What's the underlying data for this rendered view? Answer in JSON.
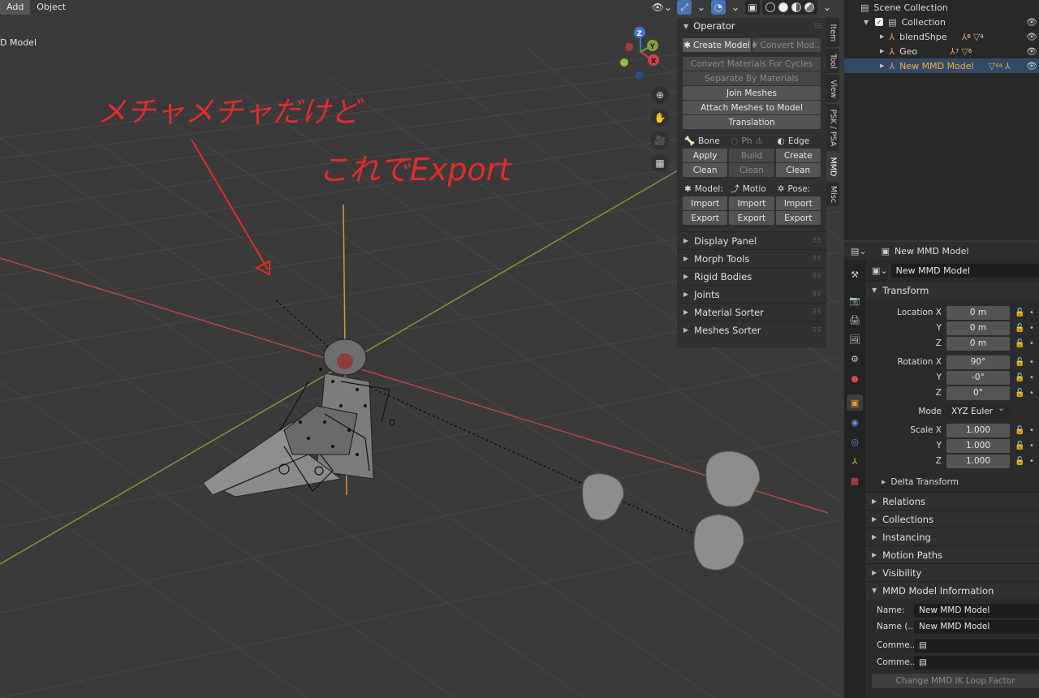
{
  "viewport": {
    "menu": [
      "Add",
      "Object"
    ],
    "label": "D Model",
    "annotation_a": "メチャメチャだけど",
    "annotation_b": "これでExport",
    "colors": {
      "x_axis": "#c94a4a",
      "y_axis": "#7fa33a",
      "z_axis": "#e0923a",
      "ink": "#e22b2b"
    }
  },
  "gizmo": {
    "x": "X",
    "y": "Y",
    "z": "Z"
  },
  "npanel": {
    "operator": {
      "title": "Operator",
      "create_model": "Create Model",
      "convert_model": "Convert Mod...",
      "actions": [
        "Convert Materials For Cycles",
        "Separate By Materials",
        "Join Meshes",
        "Attach Meshes to Model",
        "Translation"
      ]
    },
    "bone_row": {
      "bone": "Bone",
      "physics": "Ph",
      "edge": "Edge"
    },
    "apply_row": [
      "Apply",
      "Build",
      "Create"
    ],
    "clean_row": [
      "Clean",
      "Clean",
      "Clean"
    ],
    "io_row": {
      "model": "Model:",
      "motion": "Motio",
      "pose": "Pose:"
    },
    "import_row": [
      "Import",
      "Import",
      "Import"
    ],
    "export_row": [
      "Export",
      "Export",
      "Export"
    ],
    "panels": [
      "Display Panel",
      "Morph Tools",
      "Rigid Bodies",
      "Joints",
      "Material Sorter",
      "Meshes Sorter"
    ]
  },
  "vtabs": [
    "Item",
    "Tool",
    "View",
    "PSK / PSA",
    "MMD",
    "Misc"
  ],
  "outliner": {
    "scene_collection": "Scene Collection",
    "collection": "Collection",
    "items": [
      {
        "name": "blendShpe",
        "count_a": "6",
        "count_b": "4"
      },
      {
        "name": "Geo",
        "count_a": "7",
        "count_b": "6"
      },
      {
        "name": "New MMD Model",
        "count_a": "44",
        "count_b": ""
      }
    ]
  },
  "properties": {
    "header_title": "New MMD Model",
    "object_name": "New MMD Model",
    "transform": {
      "title": "Transform",
      "location": {
        "label": "Location X",
        "x": "0 m",
        "y": "0 m",
        "z": "0 m"
      },
      "rotation": {
        "label": "Rotation X",
        "x": "90°",
        "y": "-0°",
        "z": "0°"
      },
      "mode_label": "Mode",
      "mode_value": "XYZ Euler",
      "scale": {
        "label": "Scale X",
        "x": "1.000",
        "y": "1.000",
        "z": "1.000"
      },
      "axis_y": "Y",
      "axis_z": "Z",
      "delta": "Delta Transform"
    },
    "sections": [
      "Relations",
      "Collections",
      "Instancing",
      "Motion Paths",
      "Visibility"
    ],
    "mmd_info": {
      "title": "MMD Model Information",
      "name_label": "Name:",
      "name_value": "New MMD Model",
      "name_e_label": "Name (..",
      "name_e_value": "New MMD Model",
      "comment_label": "Comme..",
      "comment_e_label": "Comme..",
      "ik_button": "Change MMD IK Loop Factor"
    }
  }
}
